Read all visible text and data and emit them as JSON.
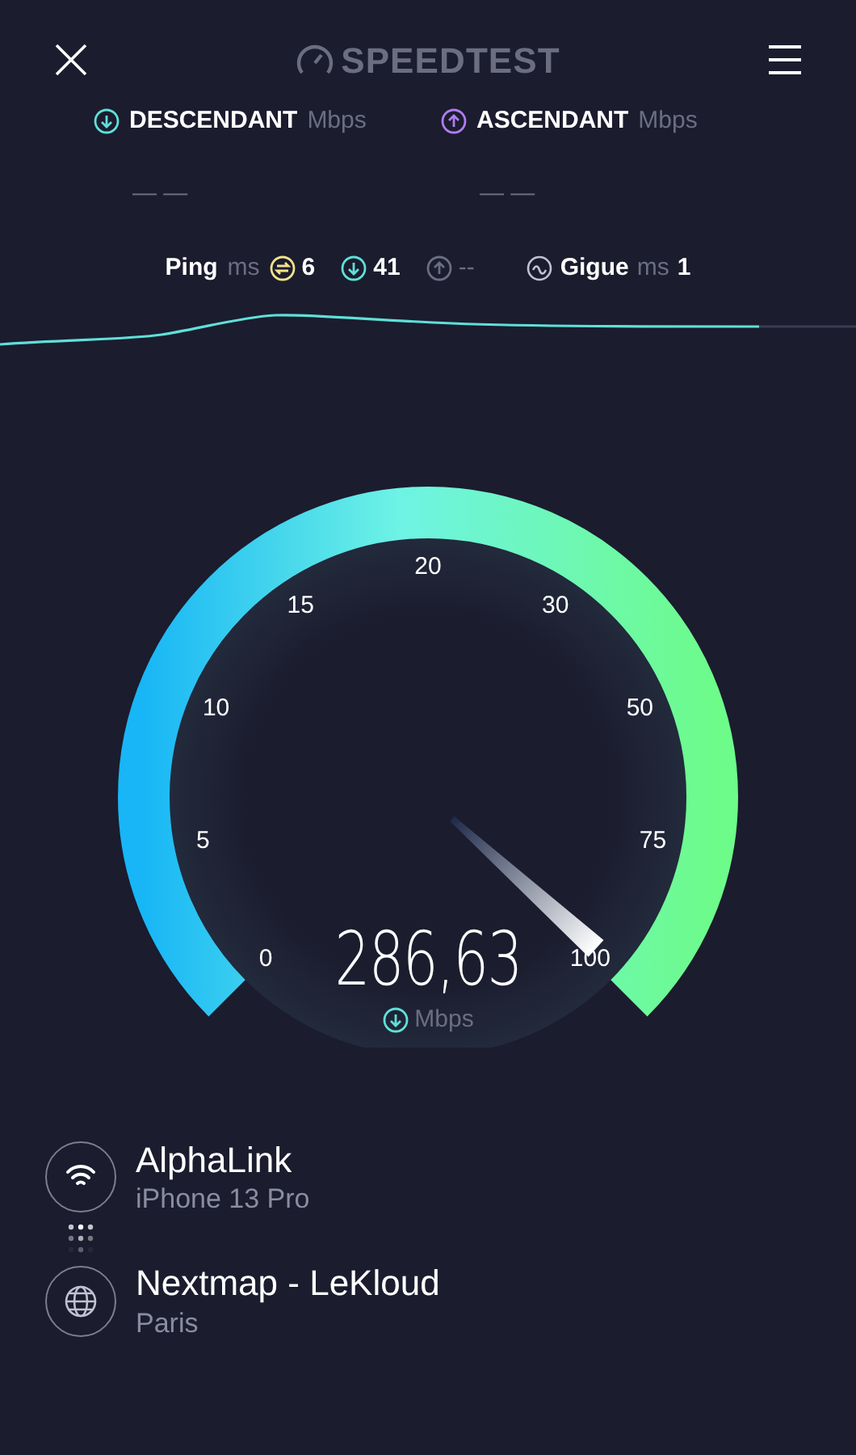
{
  "header": {
    "logo": "SPEEDTEST"
  },
  "results": [
    {
      "kind": "download",
      "label": "DESCENDANT",
      "unit": "Mbps",
      "value": "— —"
    },
    {
      "kind": "upload",
      "label": "ASCENDANT",
      "unit": "Mbps",
      "value": "— —"
    }
  ],
  "ping": {
    "label": "Ping",
    "unit": "ms",
    "values": [
      {
        "kind": "idle",
        "value": "6"
      },
      {
        "kind": "download",
        "value": "41"
      },
      {
        "kind": "upload",
        "value": "--"
      }
    ]
  },
  "jitter": {
    "label": "Gigue",
    "unit": "ms",
    "value": "1"
  },
  "gauge": {
    "ticks": [
      "0",
      "5",
      "10",
      "15",
      "20",
      "30",
      "50",
      "75",
      "100"
    ],
    "reading": "286,63",
    "unit": "Mbps"
  },
  "connections": [
    {
      "kind": "wifi",
      "name": "AlphaLink",
      "detail": "iPhone 13 Pro"
    },
    {
      "kind": "server",
      "name": "Nextmap - LeKloud",
      "detail": "Paris"
    }
  ]
}
